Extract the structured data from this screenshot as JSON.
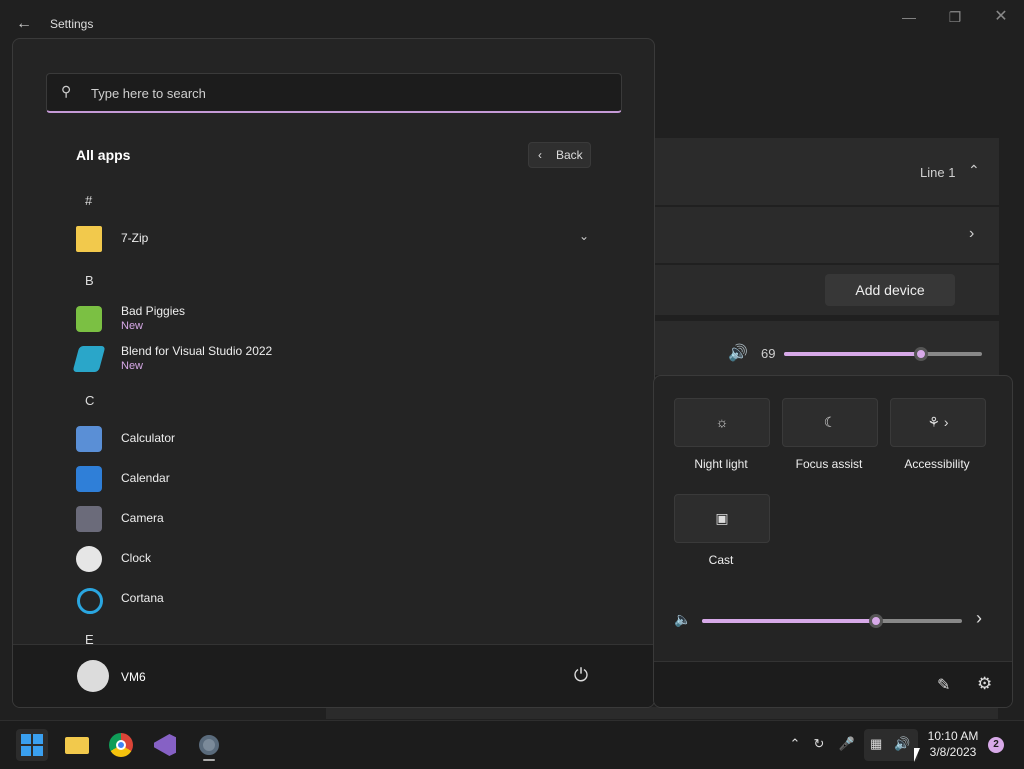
{
  "window": {
    "title": "Settings",
    "back_icon": "arrow-left-icon",
    "minimize_icon": "minimize-icon",
    "maximize_icon": "restore-icon",
    "close_icon": "close-icon"
  },
  "settings_bg": {
    "line_label": "Line 1",
    "add_device_label": "Add device",
    "volume_value": "69",
    "volume_level": 0.69
  },
  "start_menu": {
    "search": {
      "placeholder": "Type here to search",
      "value": ""
    },
    "all_apps_title": "All apps",
    "back_label": "Back",
    "letters": [
      "#",
      "B",
      "C",
      "E"
    ],
    "apps": [
      {
        "name": "7-Zip",
        "icon": "folder-icon",
        "badge": ""
      },
      {
        "name": "Bad Piggies",
        "icon": "bad-piggies-icon",
        "badge": "New"
      },
      {
        "name": "Blend for Visual Studio 2022",
        "icon": "blend-icon",
        "badge": "New"
      },
      {
        "name": "Calculator",
        "icon": "calculator-icon",
        "badge": ""
      },
      {
        "name": "Calendar",
        "icon": "calendar-icon",
        "badge": ""
      },
      {
        "name": "Camera",
        "icon": "camera-icon",
        "badge": ""
      },
      {
        "name": "Clock",
        "icon": "clock-icon",
        "badge": ""
      },
      {
        "name": "Cortana",
        "icon": "cortana-icon",
        "badge": ""
      }
    ],
    "user_name": "VM6",
    "power_icon": "power-icon"
  },
  "quick_settings": {
    "tiles": [
      {
        "label": "Night light",
        "icon": "night-light-icon"
      },
      {
        "label": "Focus assist",
        "icon": "moon-icon"
      },
      {
        "label": "Accessibility",
        "icon": "accessibility-icon"
      },
      {
        "label": "Cast",
        "icon": "cast-icon"
      }
    ],
    "volume_level": 0.67,
    "edit_icon": "pencil-icon",
    "settings_icon": "gear-icon"
  },
  "taskbar": {
    "apps": [
      "start-icon",
      "file-explorer-icon",
      "chrome-icon",
      "visual-studio-icon",
      "settings-app-icon"
    ],
    "time": "10:10 AM",
    "date": "3/8/2023",
    "notification_count": "2",
    "accent_color": "#d7a9e8"
  }
}
